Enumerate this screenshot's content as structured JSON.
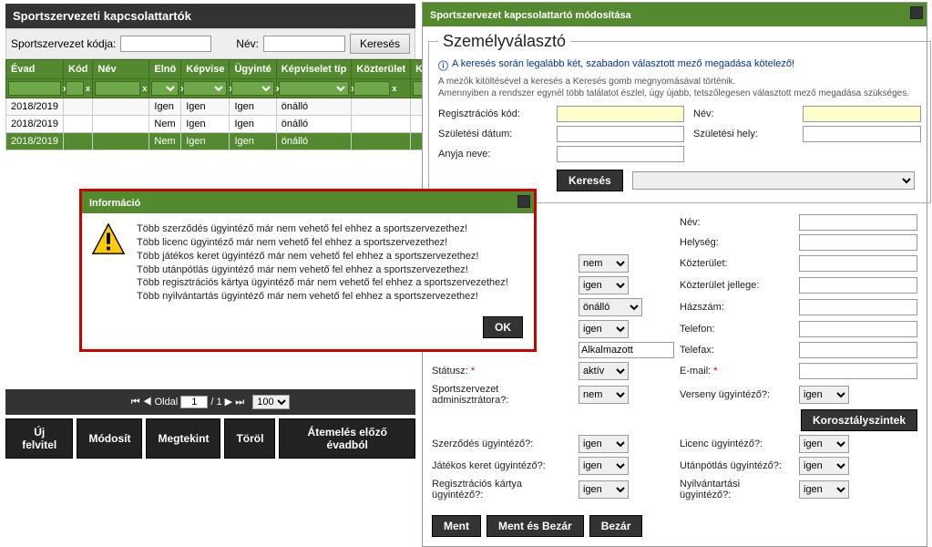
{
  "left": {
    "title": "Sportszervezeti kapcsolattartók",
    "filter": {
      "code_label": "Sportszervezet kódja:",
      "name_label": "Név:",
      "search_btn": "Keresés"
    },
    "columns": {
      "evad": "Évad",
      "kod": "Kód",
      "nev": "Név",
      "elnok": "Elnö",
      "kepvise": "Képvise",
      "ugyinte": "Ügyinté",
      "kepviselet_tip": "Képviselet típ",
      "kozterulet": "Közterület",
      "kozter": "Közter"
    },
    "rows": [
      {
        "evad": "2018/2019",
        "kod": "",
        "nev": "",
        "elnok": "Igen",
        "kepvise": "Igen",
        "ugyinte": "Igen",
        "ktip": "önálló"
      },
      {
        "evad": "2018/2019",
        "kod": "",
        "nev": "",
        "elnok": "Nem",
        "kepvise": "Igen",
        "ugyinte": "Igen",
        "ktip": "önálló"
      },
      {
        "evad": "2018/2019",
        "kod": "",
        "nev": "",
        "elnok": "Nem",
        "kepvise": "Igen",
        "ugyinte": "Igen",
        "ktip": "önálló"
      }
    ],
    "pager": {
      "label_oldal": "Oldal",
      "page": "1",
      "total": "/ 1",
      "perpage": "100"
    },
    "buttons": {
      "uj": "Új felvitel",
      "modosit": "Módosít",
      "megtekint": "Megtekint",
      "torol": "Töröl",
      "atemeles": "Átemelés előző évadból"
    }
  },
  "dialog": {
    "title": "Információ",
    "lines": [
      "Több szerződés ügyintéző már nem vehető fel ehhez a sportszervezethez!",
      "Több licenc ügyintéző már nem vehető fel ehhez a sportszervezethez!",
      "Több játékos keret ügyintéző már nem vehető fel ehhez a sportszervezethez!",
      "Több utánpótlás ügyintéző már nem vehető fel ehhez a sportszervezethez!",
      "Több regisztrációs kártya ügyintéző már nem vehető fel ehhez a sportszervezethez!",
      "Több nyilvántartás ügyintéző már nem vehető fel ehhez a sportszervezethez!"
    ],
    "ok": "OK"
  },
  "right": {
    "title": "Sportszervezet kapcsolattartó módosítása",
    "chooser": {
      "legend": "Személyválasztó",
      "info1": "A keresés során legalább két, szabadon választott mező megadása kötelező!",
      "info2": "A mezők kitöltésével a keresés a Keresés gomb megnyomásával történik.",
      "info3": "Amennyiben a rendszer egynél több találatot észlel, úgy újabb, tetszőlegesen választott mező megadása szükséges.",
      "reg_label": "Regisztrációs kód:",
      "nev_label": "Név:",
      "szul_datum_label": "Születési dátum:",
      "szul_hely_label": "Születési hely:",
      "anyja_label": "Anyja neve:",
      "search_btn": "Keresés"
    },
    "detail": {
      "labels": {
        "nev": "Név:",
        "helyseg": "Helység:",
        "kozterulet": "Közterület:",
        "kozterulet_jellege": "Közterület jellege:",
        "hazszam": "Házszám:",
        "telefon": "Telefon:",
        "telefax": "Telefax:",
        "email": "E-mail:",
        "verseny": "Verseny ügyintéző?:",
        "statusz": "Státusz:",
        "admin": "Sportszervezet adminisztrátora?:",
        "szerzodes": "Szerződés ügyintéző?:",
        "licenc": "Licenc ügyintéző?:",
        "jatekos": "Játékos keret ügyintéző?:",
        "utanpotlas": "Utánpótlás ügyintéző?:",
        "regkartya": "Regisztrációs kártya ügyintéző?:",
        "nyilvantartasi": "Nyilvántartási ügyintéző?:"
      },
      "values": {
        "sel_nem": "nem",
        "sel_igen": "igen",
        "sel_onallo": "önálló",
        "alkalmazott": "Alkalmazott",
        "aktiv": "aktív"
      },
      "korosztaly_btn": "Korosztályszintek"
    },
    "buttons": {
      "ment": "Ment",
      "ment_bezar": "Ment és Bezár",
      "bezar": "Bezár"
    }
  }
}
